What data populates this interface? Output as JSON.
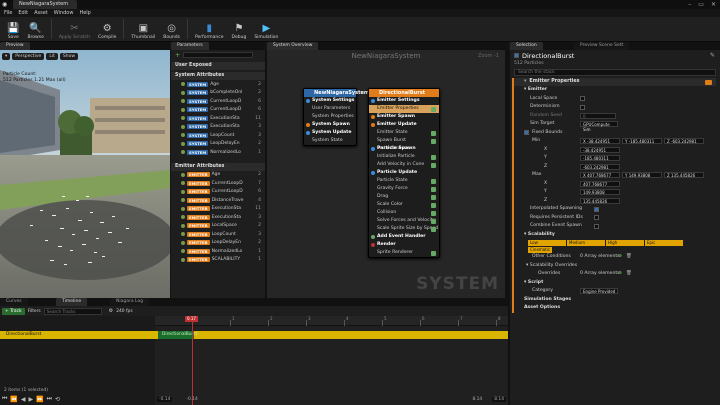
{
  "window": {
    "tab_title": "NewNiagaraSystem",
    "controls": [
      "–",
      "▭",
      "✕"
    ]
  },
  "menu": [
    "File",
    "Edit",
    "Asset",
    "Window",
    "Help"
  ],
  "toolbar": [
    {
      "label": "Save",
      "icon": "💾"
    },
    {
      "label": "Browse",
      "icon": "🔍"
    },
    {
      "label": "Apply Scratch",
      "icon": "✂"
    },
    {
      "label": "Compile",
      "icon": "⚙"
    },
    {
      "label": "Thumbnail",
      "icon": "▣"
    },
    {
      "label": "Bounds",
      "icon": "◎"
    },
    {
      "label": "Performance",
      "icon": "▮"
    },
    {
      "label": "Debug",
      "icon": "⚑"
    },
    {
      "label": "Simulation",
      "icon": "▶"
    }
  ],
  "panels": {
    "preview": "Preview",
    "parameters": "Parameters",
    "system_overview": "System Overview",
    "selection": "Selection",
    "preview_scene": "Preview Scene Sett"
  },
  "viewport": {
    "perspective": "Perspective",
    "lit": "Lit",
    "show": "Show",
    "stats": [
      "Particle Count:",
      "512 Particles 1.21 Max (all)"
    ]
  },
  "parameters": {
    "user_exposed": "User Exposed",
    "system_attributes": "System Attributes",
    "emitter_attributes": "Emitter Attributes",
    "system_rows": [
      {
        "tag": "SYSTEM",
        "name": "Age",
        "count": "2"
      },
      {
        "tag": "SYSTEM",
        "name": "bCompleteOnl",
        "count": "2"
      },
      {
        "tag": "SYSTEM",
        "name": "CurrentLoopD",
        "count": "6"
      },
      {
        "tag": "SYSTEM",
        "name": "CurrentLoopD",
        "count": "6"
      },
      {
        "tag": "SYSTEM",
        "name": "ExecutionSta",
        "count": "11"
      },
      {
        "tag": "SYSTEM",
        "name": "ExecutionSta",
        "count": "3"
      },
      {
        "tag": "SYSTEM",
        "name": "LoopCount",
        "count": "3"
      },
      {
        "tag": "SYSTEM",
        "name": "LoopDelayEn",
        "count": "2"
      },
      {
        "tag": "SYSTEM",
        "name": "NormalizedLo",
        "count": "1"
      }
    ],
    "emitter_rows": [
      {
        "tag": "EMITTER",
        "name": "Age",
        "count": "2"
      },
      {
        "tag": "EMITTER",
        "name": "CurrentLoopD",
        "count": "7"
      },
      {
        "tag": "EMITTER",
        "name": "CurrentLoopD",
        "count": "6"
      },
      {
        "tag": "EMITTER",
        "name": "DistanceTrave",
        "count": "4"
      },
      {
        "tag": "EMITTER",
        "name": "ExecutionSta",
        "count": "11"
      },
      {
        "tag": "EMITTER",
        "name": "ExecutionSta",
        "count": "3"
      },
      {
        "tag": "EMITTER",
        "name": "LocalSpace",
        "count": "2"
      },
      {
        "tag": "EMITTER",
        "name": "LoopCount",
        "count": "3"
      },
      {
        "tag": "EMITTER",
        "name": "LoopDelayEn",
        "count": "2"
      },
      {
        "tag": "EMITTER",
        "name": "NormalizedLo",
        "count": "1"
      },
      {
        "tag": "EMITTER",
        "name": "SCALABILITY",
        "count": "1"
      }
    ]
  },
  "graph": {
    "title": "NewNiagaraSystem",
    "zoom": "Zoom -1",
    "watermark": "SYSTEM",
    "system_node": {
      "title": "NewNiagaraSystem",
      "rows": [
        "System Settings",
        "User Parameters",
        "System Properties",
        "System Spawn",
        "System Update",
        "System State"
      ]
    },
    "emitter_node": {
      "title": "DirectionalBurst",
      "rows": [
        "Emitter Settings",
        "Emitter Properties",
        "Emitter Spawn",
        "Emitter Update",
        "Emitter State",
        "Spawn Burst Instantaneous",
        "Particle Spawn",
        "Initialize Particle",
        "Add Velocity in Cone",
        "Particle Update",
        "Particle State",
        "Gravity Force",
        "Drag",
        "Scale Color",
        "Collision",
        "Solve Forces and Velocity",
        "Scale Sprite Size by Speed",
        "Add Event Handler",
        "Render",
        "Sprite Renderer"
      ]
    }
  },
  "details": {
    "emitter_name": "DirectionalBurst",
    "particles": "512 Particles",
    "search_placeholder": "Search the stack",
    "section_title": "Emitter Properties",
    "emitter_cat": "Emitter",
    "local_space": "Local Space",
    "determinism": "Determinism",
    "random_seed": "Random Seed",
    "random_seed_val": "0",
    "sim_target": "Sim Target",
    "sim_target_val": "GPUCompute Sim",
    "fixed_bounds": "Fixed Bounds",
    "min": "Min",
    "min_x": "X -38.424951",
    "min_y": "Y -185.480311",
    "min_z": "Z -603.242981",
    "min_rows": [
      "-38.424951",
      "-185.480311",
      "-603.242981"
    ],
    "max": "Max",
    "max_x": "X 407.768677",
    "max_y": "Y 149.93808",
    "max_z": "Z 135.445826",
    "max_rows": [
      "407.768677",
      "149.93808",
      "135.445826"
    ],
    "axes": [
      "X",
      "Y",
      "Z"
    ],
    "interp": "Interpolated Spawning",
    "req_ids": "Requires Persistent IDs",
    "combine": "Combine Event Spawn",
    "scalability": "Scalability",
    "scal_tabs": [
      "Low",
      "Medium",
      "High",
      "Epic"
    ],
    "cinematic": "Cinematic",
    "other_conditions": "Other Conditions",
    "array_elements": "0 Array elements",
    "scal_overrides": "Scalability Overrides",
    "overrides": "Overrides",
    "script": "Script",
    "category": "Category",
    "category_val": "Engine Provided",
    "sim_stages": "Simulation Stages",
    "asset_options": "Asset Options"
  },
  "timeline": {
    "tabs": [
      "Curves",
      "Timeline",
      "Niagara Log"
    ],
    "track_btn": "+ Track",
    "filters": "Filters",
    "search_placeholder": "Search Tracks",
    "fps": "240 fps",
    "playhead": "0.17",
    "track": "DirectionalBurst",
    "bar_label": "DirectionalBurst",
    "items_selected": "2 items (1 selected)",
    "start": "-0.14",
    "start2": "-0.14",
    "end": "8.14",
    "end2": "8.14",
    "ticks": [
      "0",
      "1",
      "2",
      "3",
      "4",
      "5",
      "6",
      "7",
      "8"
    ],
    "colors": {
      "track": "#d9b500",
      "bar": "#1b6d2b"
    }
  },
  "colors": {
    "system": "#2e67a5",
    "emitter": "#e07c1a",
    "accent": "#e2a400"
  }
}
